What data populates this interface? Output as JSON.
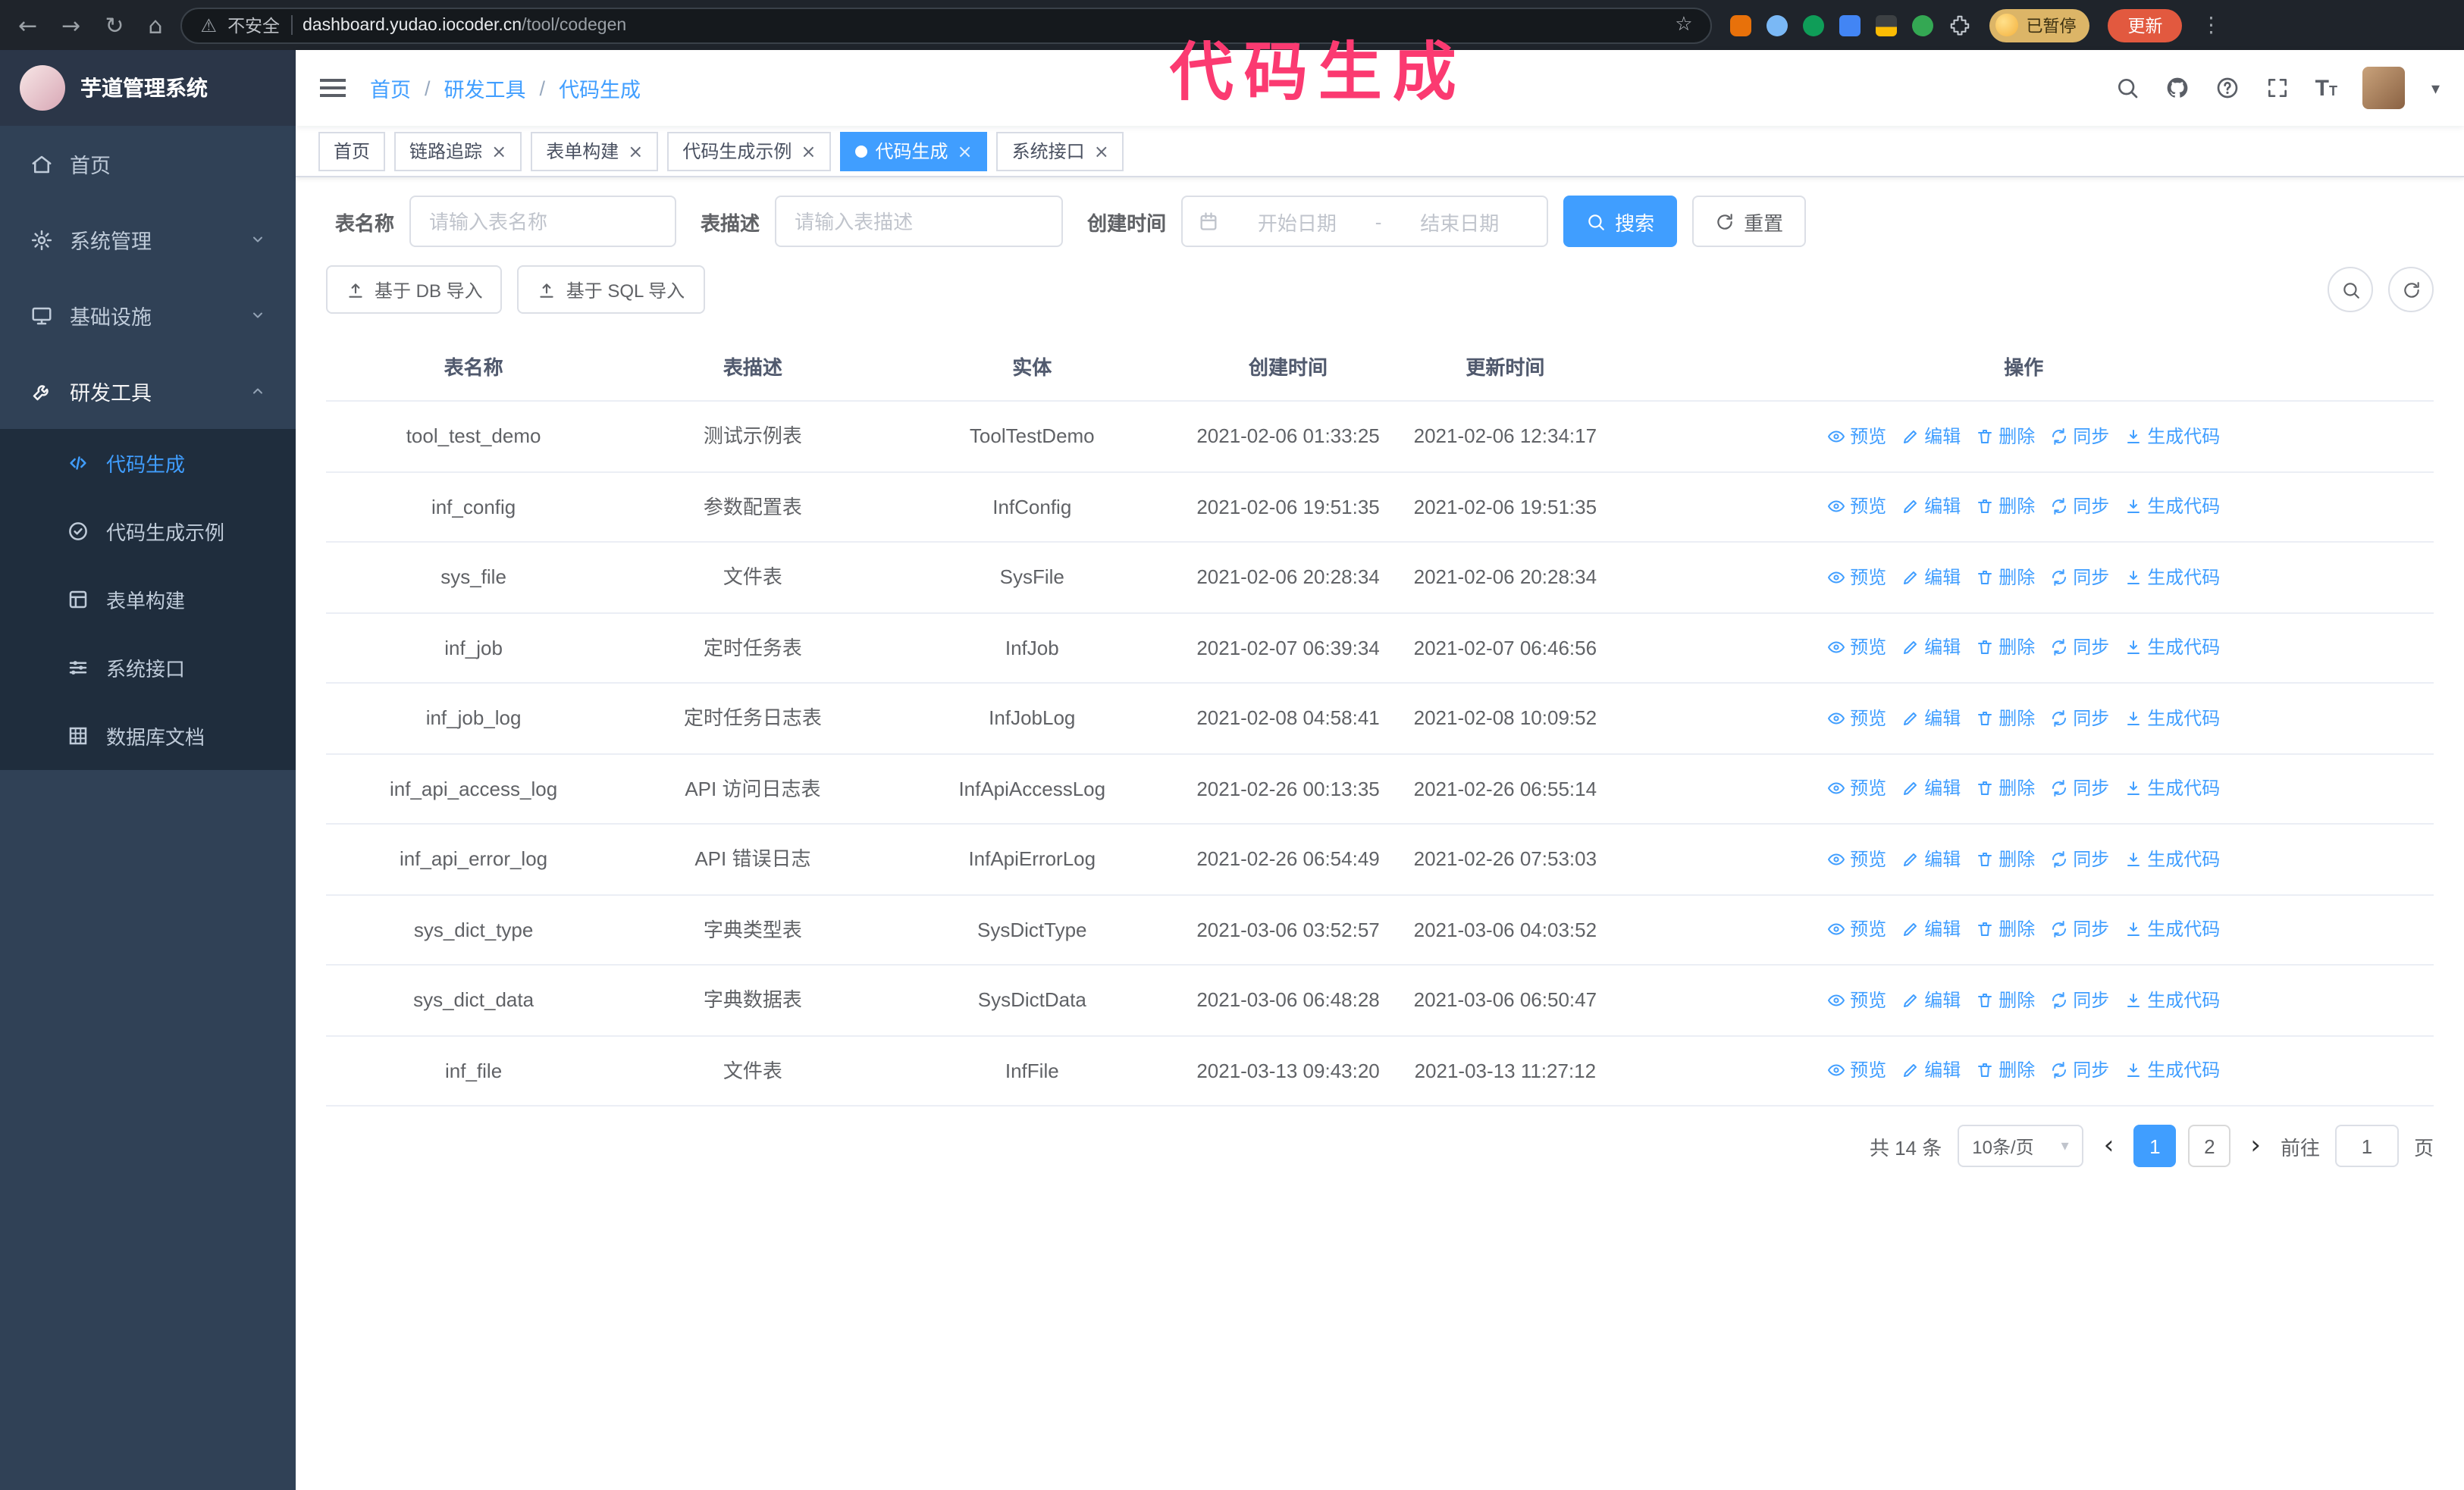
{
  "theme": {
    "accent": "#409eff",
    "sidebar_bg": "#304156",
    "submenu_bg": "#1f2d3d"
  },
  "annotation": {
    "text": "代码生成",
    "color": "#fb3a71"
  },
  "icons": {
    "back": "←",
    "forward": "→",
    "reload": "↻",
    "home": "⌂",
    "warning": "⚠",
    "star": "☆",
    "kebab": "⋮",
    "close": "×",
    "prev": "‹",
    "next": "›",
    "caret": "▾",
    "font_size": "T"
  },
  "browser": {
    "security_label": "不安全",
    "url_host": "dashboard.yudao.iocoder.cn",
    "url_path": "/tool/codegen",
    "paused_badge": "已暂停",
    "update_label": "更新"
  },
  "app": {
    "logo_title": "芋道管理系统"
  },
  "sidebar": {
    "items": [
      {
        "key": "home",
        "label": "首页",
        "icon": "i-home",
        "type": "item",
        "expanded": false
      },
      {
        "key": "system",
        "label": "系统管理",
        "icon": "i-gear",
        "type": "group",
        "expanded": false
      },
      {
        "key": "infra",
        "label": "基础设施",
        "icon": "i-monitor",
        "type": "group",
        "expanded": false
      },
      {
        "key": "devtools",
        "label": "研发工具",
        "icon": "i-tools",
        "type": "group",
        "expanded": true
      }
    ],
    "sub_items": [
      {
        "key": "codegen",
        "label": "代码生成",
        "icon": "i-code",
        "active": true
      },
      {
        "key": "codegen-example",
        "label": "代码生成示例",
        "icon": "i-badge",
        "active": false
      },
      {
        "key": "form-builder",
        "label": "表单构建",
        "icon": "i-form",
        "active": false
      },
      {
        "key": "system-api",
        "label": "系统接口",
        "icon": "i-sliders",
        "active": false
      },
      {
        "key": "db-doc",
        "label": "数据库文档",
        "icon": "i-grid",
        "active": false
      }
    ]
  },
  "breadcrumb": {
    "items": [
      "首页",
      "研发工具",
      "代码生成"
    ],
    "separator": "/"
  },
  "tabs": [
    {
      "key": "home",
      "label": "首页",
      "closable": false,
      "active": false
    },
    {
      "key": "trace",
      "label": "链路追踪",
      "closable": true,
      "active": false
    },
    {
      "key": "form-builder",
      "label": "表单构建",
      "closable": true,
      "active": false
    },
    {
      "key": "codegen-example",
      "label": "代码生成示例",
      "closable": true,
      "active": false
    },
    {
      "key": "codegen",
      "label": "代码生成",
      "closable": true,
      "active": true
    },
    {
      "key": "system-api",
      "label": "系统接口",
      "closable": true,
      "active": false
    }
  ],
  "filters": {
    "name_label": "表名称",
    "name_placeholder": "请输入表名称",
    "desc_label": "表描述",
    "desc_placeholder": "请输入表描述",
    "time_label": "创建时间",
    "start_placeholder": "开始日期",
    "range_separator": "-",
    "end_placeholder": "结束日期",
    "search_label": "搜索",
    "reset_label": "重置"
  },
  "toolbar": {
    "import_db_label": "基于 DB 导入",
    "import_sql_label": "基于 SQL 导入"
  },
  "table": {
    "columns": [
      "表名称",
      "表描述",
      "实体",
      "创建时间",
      "更新时间",
      "操作"
    ],
    "actions": [
      {
        "key": "preview",
        "label": "预览",
        "icon": "i-eye"
      },
      {
        "key": "edit",
        "label": "编辑",
        "icon": "i-edit"
      },
      {
        "key": "delete",
        "label": "删除",
        "icon": "i-trash"
      },
      {
        "key": "sync",
        "label": "同步",
        "icon": "i-sync"
      },
      {
        "key": "generate-code",
        "label": "生成代码",
        "icon": "i-download"
      }
    ],
    "rows": [
      {
        "name": "tool_test_demo",
        "desc": "测试示例表",
        "entity": "ToolTestDemo",
        "created": "2021-02-06 01:33:25",
        "updated": "2021-02-06 12:34:17"
      },
      {
        "name": "inf_config",
        "desc": "参数配置表",
        "entity": "InfConfig",
        "created": "2021-02-06 19:51:35",
        "updated": "2021-02-06 19:51:35"
      },
      {
        "name": "sys_file",
        "desc": "文件表",
        "entity": "SysFile",
        "created": "2021-02-06 20:28:34",
        "updated": "2021-02-06 20:28:34"
      },
      {
        "name": "inf_job",
        "desc": "定时任务表",
        "entity": "InfJob",
        "created": "2021-02-07 06:39:34",
        "updated": "2021-02-07 06:46:56"
      },
      {
        "name": "inf_job_log",
        "desc": "定时任务日志表",
        "entity": "InfJobLog",
        "created": "2021-02-08 04:58:41",
        "updated": "2021-02-08 10:09:52"
      },
      {
        "name": "inf_api_access_log",
        "desc": "API 访问日志表",
        "entity": "InfApiAccessLog",
        "created": "2021-02-26 00:13:35",
        "updated": "2021-02-26 06:55:14"
      },
      {
        "name": "inf_api_error_log",
        "desc": "API 错误日志",
        "entity": "InfApiErrorLog",
        "created": "2021-02-26 06:54:49",
        "updated": "2021-02-26 07:53:03"
      },
      {
        "name": "sys_dict_type",
        "desc": "字典类型表",
        "entity": "SysDictType",
        "created": "2021-03-06 03:52:57",
        "updated": "2021-03-06 04:03:52"
      },
      {
        "name": "sys_dict_data",
        "desc": "字典数据表",
        "entity": "SysDictData",
        "created": "2021-03-06 06:48:28",
        "updated": "2021-03-06 06:50:47"
      },
      {
        "name": "inf_file",
        "desc": "文件表",
        "entity": "InfFile",
        "created": "2021-03-13 09:43:20",
        "updated": "2021-03-13 11:27:12"
      }
    ]
  },
  "pagination": {
    "total_text": "共 14 条",
    "page_size_text": "10条/页",
    "pages": [
      "1",
      "2"
    ],
    "active_page": "1",
    "goto_label": "前往",
    "goto_value": "1",
    "goto_suffix": "页"
  }
}
